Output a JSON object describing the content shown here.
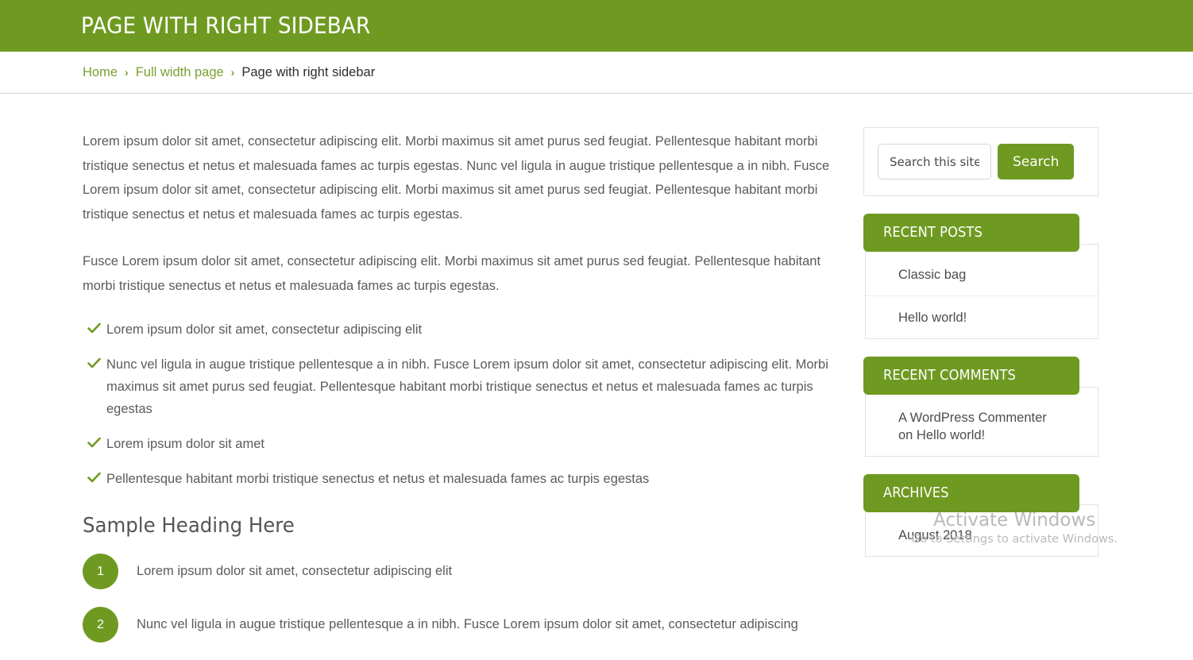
{
  "header": {
    "title": "PAGE WITH RIGHT SIDEBAR",
    "background_color": "#6f9a21"
  },
  "breadcrumb": {
    "items": [
      {
        "label": "Home",
        "is_link": true
      },
      {
        "label": "Full width page",
        "is_link": true
      },
      {
        "label": "Page with right sidebar",
        "is_link": false
      }
    ],
    "separator": "›",
    "link_color": "#7a9f32"
  },
  "content": {
    "paragraphs": [
      "Lorem ipsum dolor sit amet, consectetur adipiscing elit. Morbi maximus sit amet purus sed feugiat. Pellentesque habitant morbi tristique senectus et netus et malesuada fames ac turpis egestas. Nunc vel ligula in augue tristique pellentesque a in nibh. Fusce Lorem ipsum dolor sit amet, consectetur adipiscing elit. Morbi maximus sit amet purus sed feugiat. Pellentesque habitant morbi tristique senectus et netus et malesuada fames ac turpis egestas.",
      "Fusce Lorem ipsum dolor sit amet, consectetur adipiscing elit. Morbi maximus sit amet purus sed feugiat. Pellentesque habitant morbi tristique senectus et netus et malesuada fames ac turpis egestas."
    ],
    "check_list": [
      "Lorem ipsum dolor sit amet, consectetur adipiscing elit",
      "Nunc vel ligula in augue tristique pellentesque a in nibh. Fusce Lorem ipsum dolor sit amet, consectetur adipiscing elit. Morbi maximus sit amet purus sed feugiat. Pellentesque habitant morbi tristique senectus et netus et malesuada fames ac turpis egestas",
      "Lorem ipsum dolor sit amet",
      "Pellentesque habitant morbi tristique senectus et netus et malesuada fames ac turpis egestas"
    ],
    "heading": "Sample Heading Here",
    "numbered_list": [
      {
        "number": "1",
        "text": "Lorem ipsum dolor sit amet, consectetur adipiscing elit"
      },
      {
        "number": "2",
        "text": "Nunc vel ligula in augue tristique pellentesque a in nibh. Fusce Lorem ipsum dolor sit amet, consectetur adipiscing"
      }
    ],
    "check_icon_color": "#6f9a21",
    "badge_color": "#6f9a21"
  },
  "sidebar": {
    "search": {
      "placeholder": "Search this site...",
      "value": "",
      "button_label": "Search"
    },
    "widgets": [
      {
        "title": "RECENT POSTS",
        "items": [
          "Classic bag",
          "Hello world!"
        ]
      },
      {
        "title": "RECENT COMMENTS",
        "items": [
          "A WordPress Commenter\non Hello world!"
        ]
      },
      {
        "title": "ARCHIVES",
        "items": [
          "August 2018"
        ]
      }
    ]
  },
  "watermark": {
    "title": "Activate Windows",
    "subtitle": "Go to Settings to activate Windows."
  }
}
